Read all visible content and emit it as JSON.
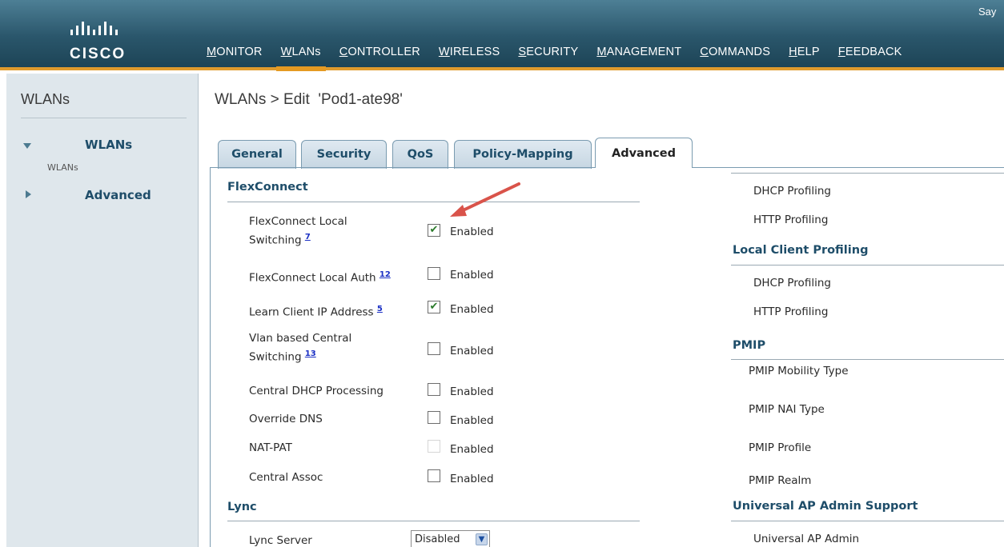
{
  "header": {
    "brand": "CISCO",
    "top_right_text": "Say",
    "nav": [
      {
        "first": "M",
        "rest": "ONITOR"
      },
      {
        "first": "W",
        "rest": "LANs"
      },
      {
        "first": "C",
        "rest": "ONTROLLER"
      },
      {
        "first": "W",
        "rest": "IRELESS"
      },
      {
        "first": "S",
        "rest": "ECURITY"
      },
      {
        "first": "M",
        "rest": "ANAGEMENT"
      },
      {
        "first": "C",
        "rest": "OMMANDS"
      },
      {
        "first": "H",
        "rest": "ELP"
      },
      {
        "first": "F",
        "rest": "EEDBACK"
      }
    ],
    "active_nav": "WLANs",
    "accent_color": "#e59a22"
  },
  "sidebar": {
    "title": "WLANs",
    "items": [
      {
        "label": "WLANs",
        "sub": "WLANs",
        "expanded": true
      },
      {
        "label": "Advanced",
        "expanded": false
      }
    ]
  },
  "breadcrumb": "WLANs > Edit  'Pod1-ate98'",
  "tabs": [
    "General",
    "Security",
    "QoS",
    "Policy-Mapping",
    "Advanced"
  ],
  "active_tab": "Advanced",
  "left": {
    "flexconnect_title": "FlexConnect",
    "rows": [
      {
        "label_line1": "FlexConnect Local",
        "label_line2": "Switching",
        "help": "7",
        "checked": true,
        "value": "Enabled"
      },
      {
        "label_line1": "FlexConnect Local Auth",
        "help": "12",
        "checked": false,
        "value": "Enabled"
      },
      {
        "label_line1": "Learn Client IP Address",
        "help": "5",
        "checked": true,
        "value": "Enabled"
      },
      {
        "label_line1": "Vlan based Central",
        "label_line2": "Switching",
        "help": "13",
        "checked": false,
        "value": "Enabled"
      },
      {
        "label_line1": "Central DHCP Processing",
        "checked": false,
        "value": "Enabled"
      },
      {
        "label_line1": "Override DNS",
        "checked": false,
        "value": "Enabled"
      },
      {
        "label_line1": "NAT-PAT",
        "checked": false,
        "disabled": true,
        "value": "Enabled"
      },
      {
        "label_line1": "Central Assoc",
        "checked": false,
        "value": "Enabled"
      }
    ],
    "lync_title": "Lync",
    "lync_server_label": "Lync Server",
    "lync_server_value": "Disabled"
  },
  "right": {
    "items_top": [
      "DHCP Profiling",
      "HTTP Profiling"
    ],
    "local_profiling_title": "Local Client Profiling",
    "local_items": [
      "DHCP Profiling",
      "HTTP Profiling"
    ],
    "pmip_title": "PMIP",
    "pmip_items": [
      "PMIP Mobility Type",
      "PMIP NAI Type",
      "PMIP Profile",
      "PMIP Realm"
    ],
    "universal_title": "Universal AP Admin Support",
    "universal_items": [
      "Universal AP Admin"
    ]
  },
  "colors": {
    "header_bg": "#2f5d73",
    "accent": "#e59a22",
    "link_blue": "#1e4d69",
    "annotation_arrow": "#d9534a"
  }
}
